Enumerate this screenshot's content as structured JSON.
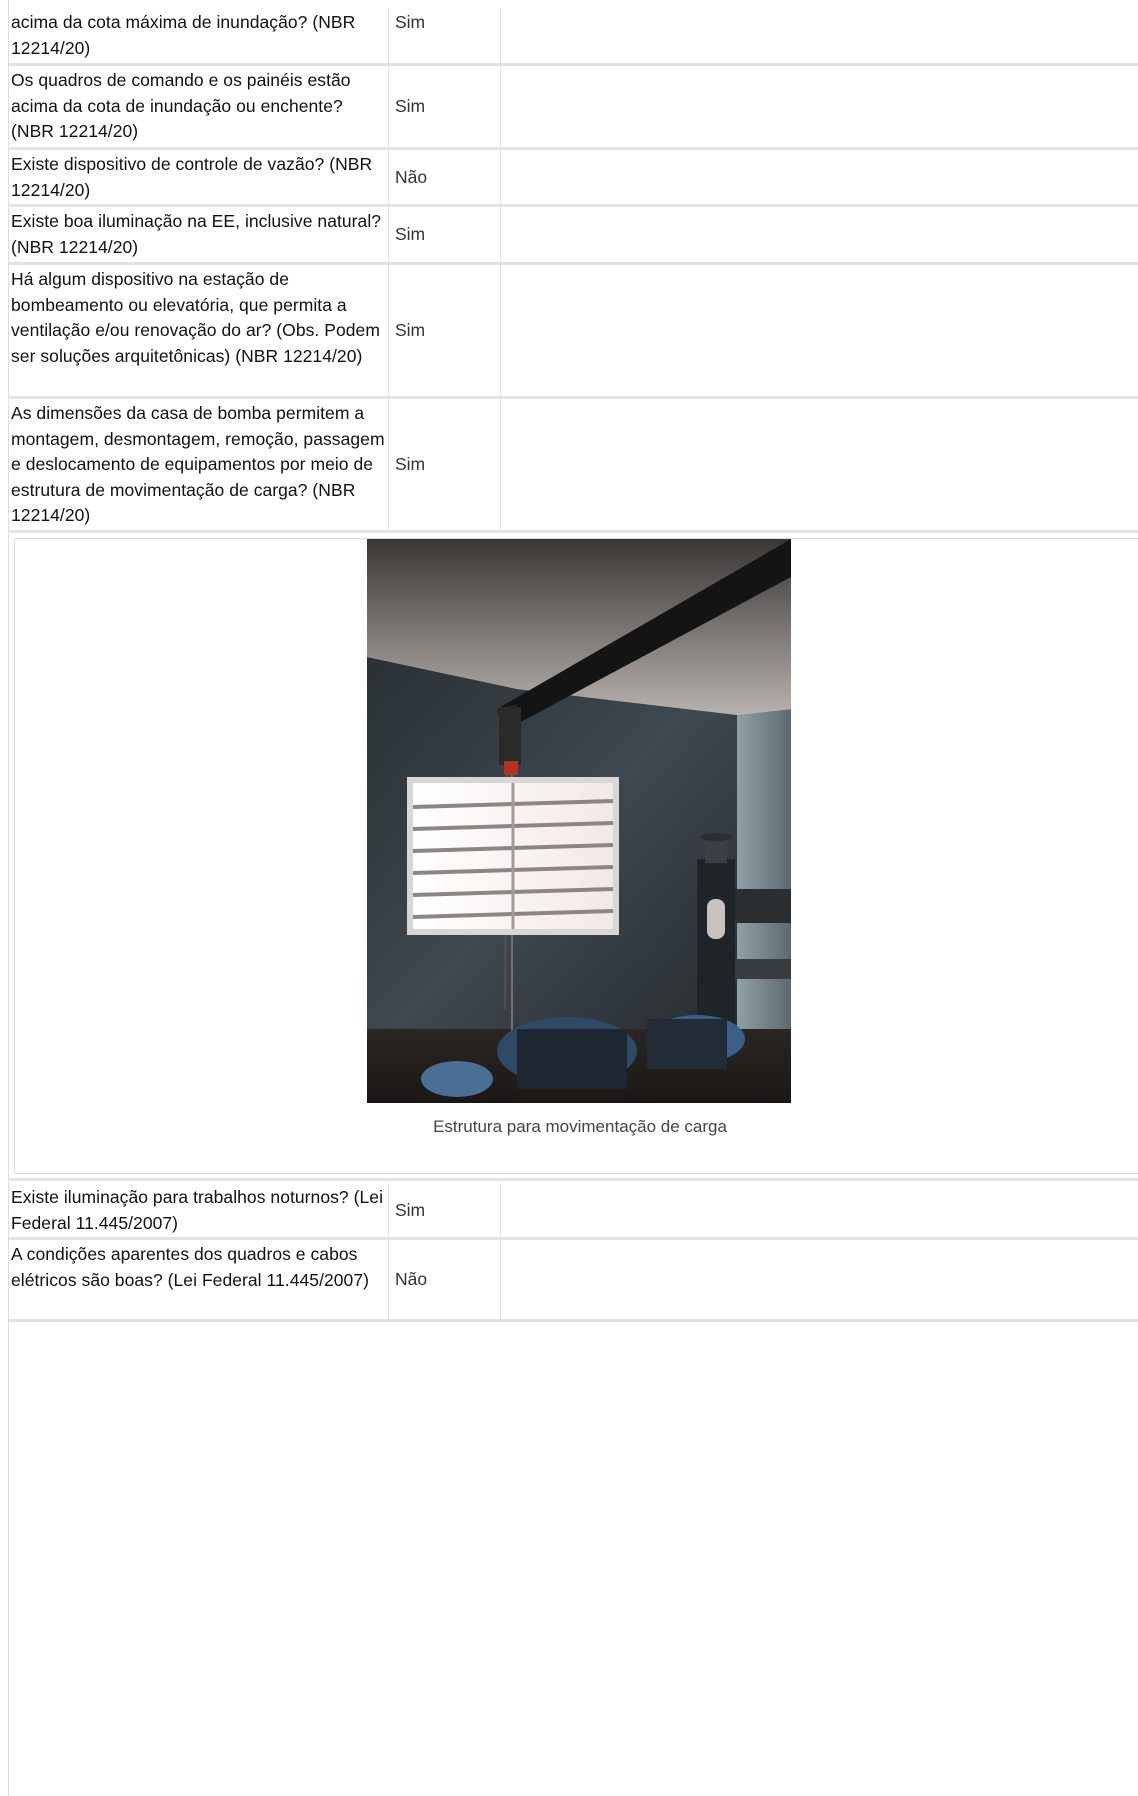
{
  "rows_top": [
    {
      "question": "acima da cota máxima de inundação? (NBR 12214/20)",
      "answer": "Sim"
    },
    {
      "question": "Os quadros de comando e os painéis estão acima da cota de inundação ou enchente? (NBR 12214/20)",
      "answer": "Sim"
    },
    {
      "question": "Existe dispositivo de controle de vazão? (NBR 12214/20)",
      "answer": "Não"
    },
    {
      "question": "Existe boa iluminação na EE, inclusive natural? (NBR 12214/20)",
      "answer": "Sim"
    },
    {
      "question": "Há algum dispositivo na estação de bombeamento ou elevatória, que permita a ventilação e/ou renovação do ar? (Obs. Podem ser soluções arquitetônicas) (NBR 12214/20)",
      "answer": "Sim"
    },
    {
      "question": "As dimensões da casa de bomba permitem a montagem, desmontagem, remoção, passagem e deslocamento de equipamentos por meio de estrutura de movimentação de carga? (NBR 12214/20)",
      "answer": "Sim"
    }
  ],
  "photo": {
    "caption": "Estrutura para movimentação de carga"
  },
  "rows_bottom": [
    {
      "question": "Existe iluminação para trabalhos noturnos? (Lei Federal 11.445/2007)",
      "answer": "Sim"
    },
    {
      "question": "A condições aparentes dos quadros e cabos elétricos são boas? (Lei Federal 11.445/2007)",
      "answer": "Não"
    }
  ]
}
